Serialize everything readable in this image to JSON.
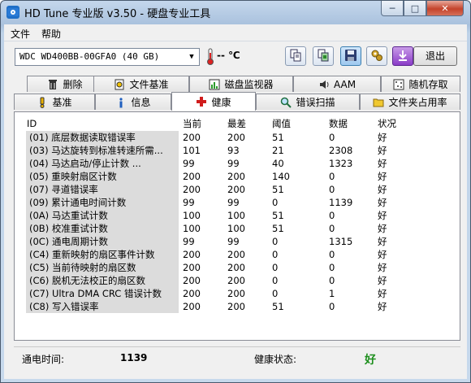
{
  "window": {
    "title": "HD Tune 专业版 v3.50 - 硬盘专业工具",
    "min_glyph": "─",
    "max_glyph": "□",
    "close_glyph": "✕"
  },
  "menu": [
    "文件",
    "帮助"
  ],
  "drive": {
    "selected": "WDC WD400BB-00GFA0 (40 GB)",
    "arrow": "▼"
  },
  "temperature": "-- ℃",
  "exit_label": "退出",
  "toolbar_icons": [
    "copy-icon",
    "copy-screenshot-icon",
    "save-icon",
    "options-icon",
    "download-icon"
  ],
  "tabs_top": [
    {
      "label": "删除",
      "icon": "trash-icon"
    },
    {
      "label": "文件基准",
      "icon": "file-benchmark-icon"
    },
    {
      "label": "磁盘监视器",
      "icon": "disk-monitor-icon"
    },
    {
      "label": "AAM",
      "icon": "speaker-icon"
    },
    {
      "label": "随机存取",
      "icon": "random-access-icon"
    }
  ],
  "tabs_bottom": [
    {
      "label": "基准",
      "icon": "benchmark-icon"
    },
    {
      "label": "信息",
      "icon": "info-icon"
    },
    {
      "label": "健康",
      "icon": "health-cross-icon",
      "selected": true
    },
    {
      "label": "错误扫描",
      "icon": "error-scan-icon"
    },
    {
      "label": "文件夹占用率",
      "icon": "folder-usage-icon"
    }
  ],
  "smart": {
    "headers": [
      "ID",
      "当前",
      "最差",
      "阈值",
      "数据",
      "状况"
    ],
    "rows": [
      [
        "(01)",
        "底层数据读取错误率",
        "200",
        "200",
        "51",
        "0",
        "好"
      ],
      [
        "(03)",
        "马达旋转到标准转速所需...",
        "101",
        "93",
        "21",
        "2308",
        "好"
      ],
      [
        "(04)",
        "马达启动/停止计数       ...",
        "99",
        "99",
        "40",
        "1323",
        "好"
      ],
      [
        "(05)",
        "重映射扇区计数",
        "200",
        "200",
        "140",
        "0",
        "好"
      ],
      [
        "(07)",
        "寻道错误率",
        "200",
        "200",
        "51",
        "0",
        "好"
      ],
      [
        "(09)",
        "累计通电时间计数",
        "99",
        "99",
        "0",
        "1139",
        "好"
      ],
      [
        "(0A)",
        "马达重试计数",
        "100",
        "100",
        "51",
        "0",
        "好"
      ],
      [
        "(0B)",
        "校准重试计数",
        "100",
        "100",
        "51",
        "0",
        "好"
      ],
      [
        "(0C)",
        "通电周期计数",
        "99",
        "99",
        "0",
        "1315",
        "好"
      ],
      [
        "(C4)",
        "重新映射的扇区事件计数",
        "200",
        "200",
        "0",
        "0",
        "好"
      ],
      [
        "(C5)",
        "当前待映射的扇区数",
        "200",
        "200",
        "0",
        "0",
        "好"
      ],
      [
        "(C6)",
        "脱机无法校正的扇区数",
        "200",
        "200",
        "0",
        "0",
        "好"
      ],
      [
        "(C7)",
        "Ultra DMA CRC 错误计数",
        "200",
        "200",
        "0",
        "1",
        "好"
      ],
      [
        "(C8)",
        "写入错误率",
        "200",
        "200",
        "51",
        "0",
        "好"
      ]
    ]
  },
  "status": {
    "power_on_label": "通电时间:",
    "power_on_value": "1139",
    "health_label": "健康状态:",
    "health_value": "好",
    "health_color": "#1d8f1d"
  }
}
